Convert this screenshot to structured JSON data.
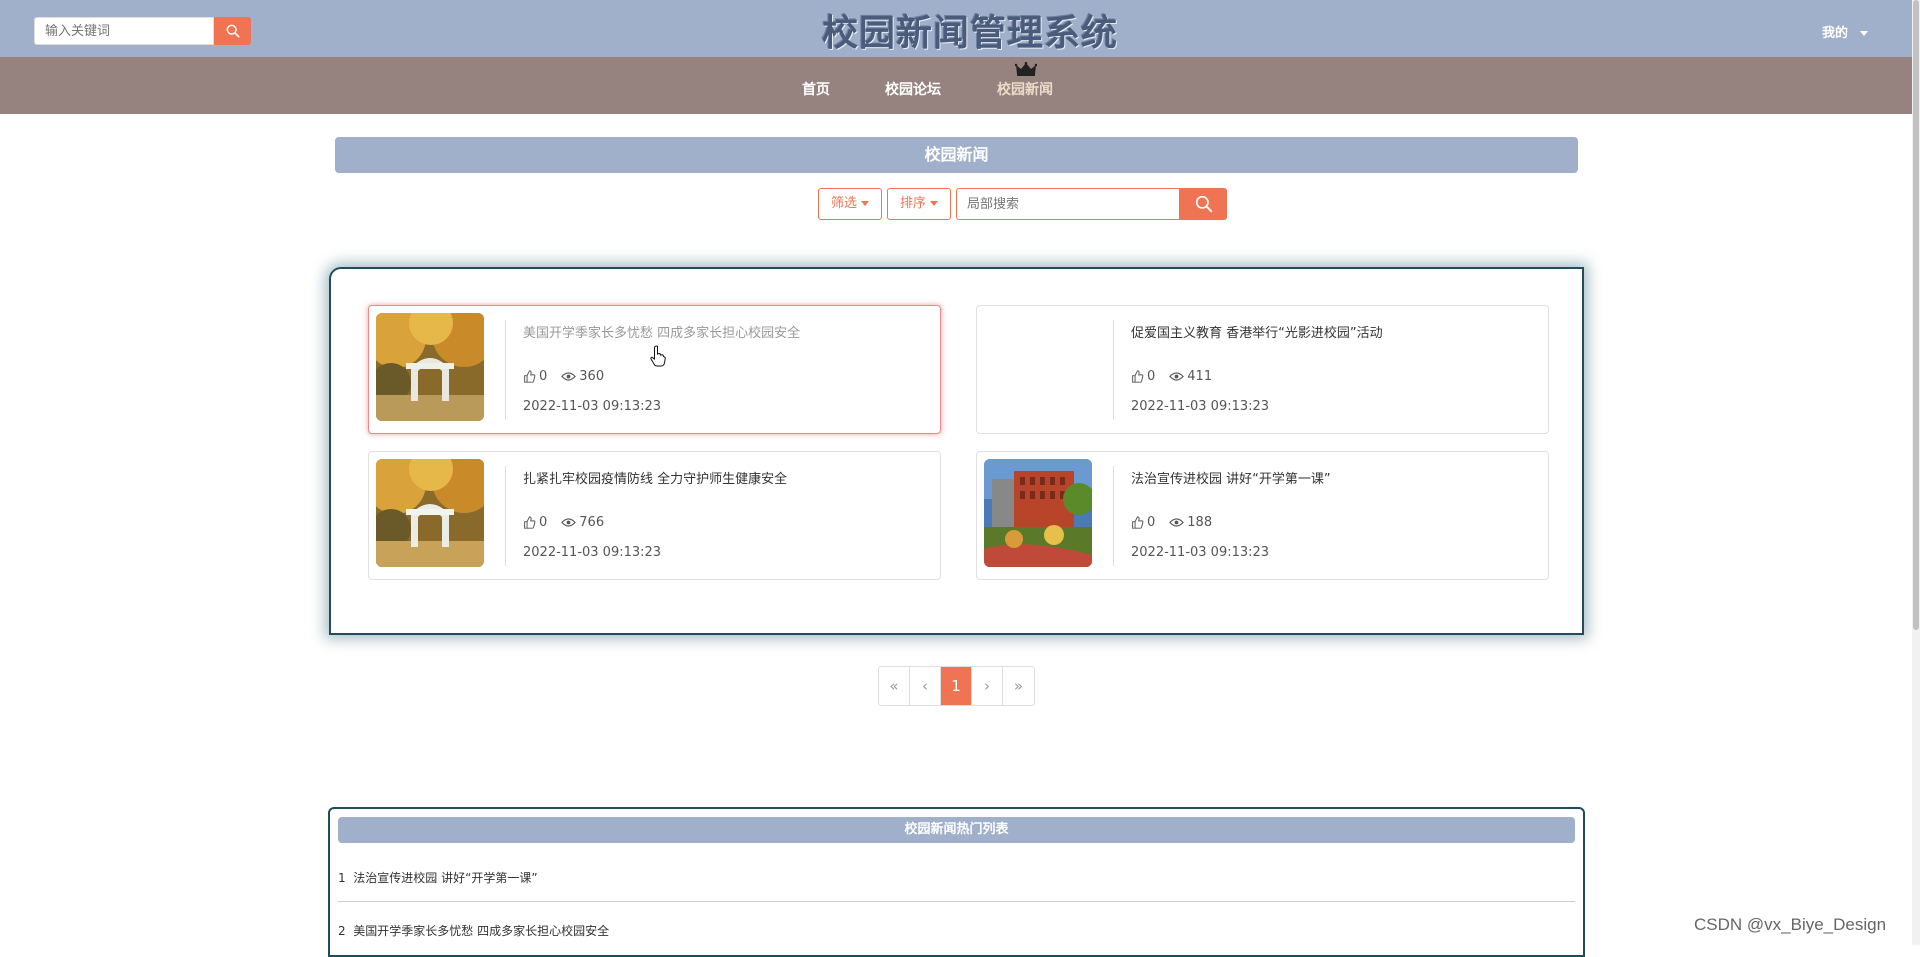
{
  "header": {
    "search_placeholder": "输入关键词",
    "site_title": "校园新闻管理系统",
    "user_menu_label": "我的"
  },
  "nav": {
    "items": [
      {
        "label": "首页",
        "active": false
      },
      {
        "label": "校园论坛",
        "active": false
      },
      {
        "label": "校园新闻",
        "active": true
      }
    ]
  },
  "section": {
    "title": "校园新闻",
    "filter_label": "筛选",
    "sort_label": "排序",
    "local_search_placeholder": "局部搜索"
  },
  "news": [
    {
      "title": "美国开学季家长多忧愁 四成多家长担心校园安全",
      "likes": "0",
      "views": "360",
      "date": "2022-11-03 09:13:23",
      "image": "autumn-gate",
      "hovered": true
    },
    {
      "title": "促爱国主义教育 香港举行“光影进校园”活动",
      "likes": "0",
      "views": "411",
      "date": "2022-11-03 09:13:23",
      "image": "none",
      "hovered": false
    },
    {
      "title": "扎紧扎牢校园疫情防线 全力守护师生健康安全",
      "likes": "0",
      "views": "766",
      "date": "2022-11-03 09:13:23",
      "image": "autumn-gate",
      "hovered": false
    },
    {
      "title": "法治宣传进校园 讲好“开学第一课”",
      "likes": "0",
      "views": "188",
      "date": "2022-11-03 09:13:23",
      "image": "red-building",
      "hovered": false
    }
  ],
  "pagination": {
    "first": "«",
    "prev": "‹",
    "current": "1",
    "next": "›",
    "last": "»"
  },
  "hot_list": {
    "title": "校园新闻热门列表",
    "items": [
      {
        "rank": "1",
        "title": "法治宣传进校园 讲好“开学第一课”"
      },
      {
        "rank": "2",
        "title": "美国开学季家长多忧愁 四成多家长担心校园安全"
      }
    ]
  },
  "watermark": "CSDN @vx_Biye_Design",
  "colors": {
    "header_bg": "#a0afca",
    "nav_bg": "#968380",
    "accent": "#ef7453",
    "panel_border": "#1f4d5e"
  }
}
